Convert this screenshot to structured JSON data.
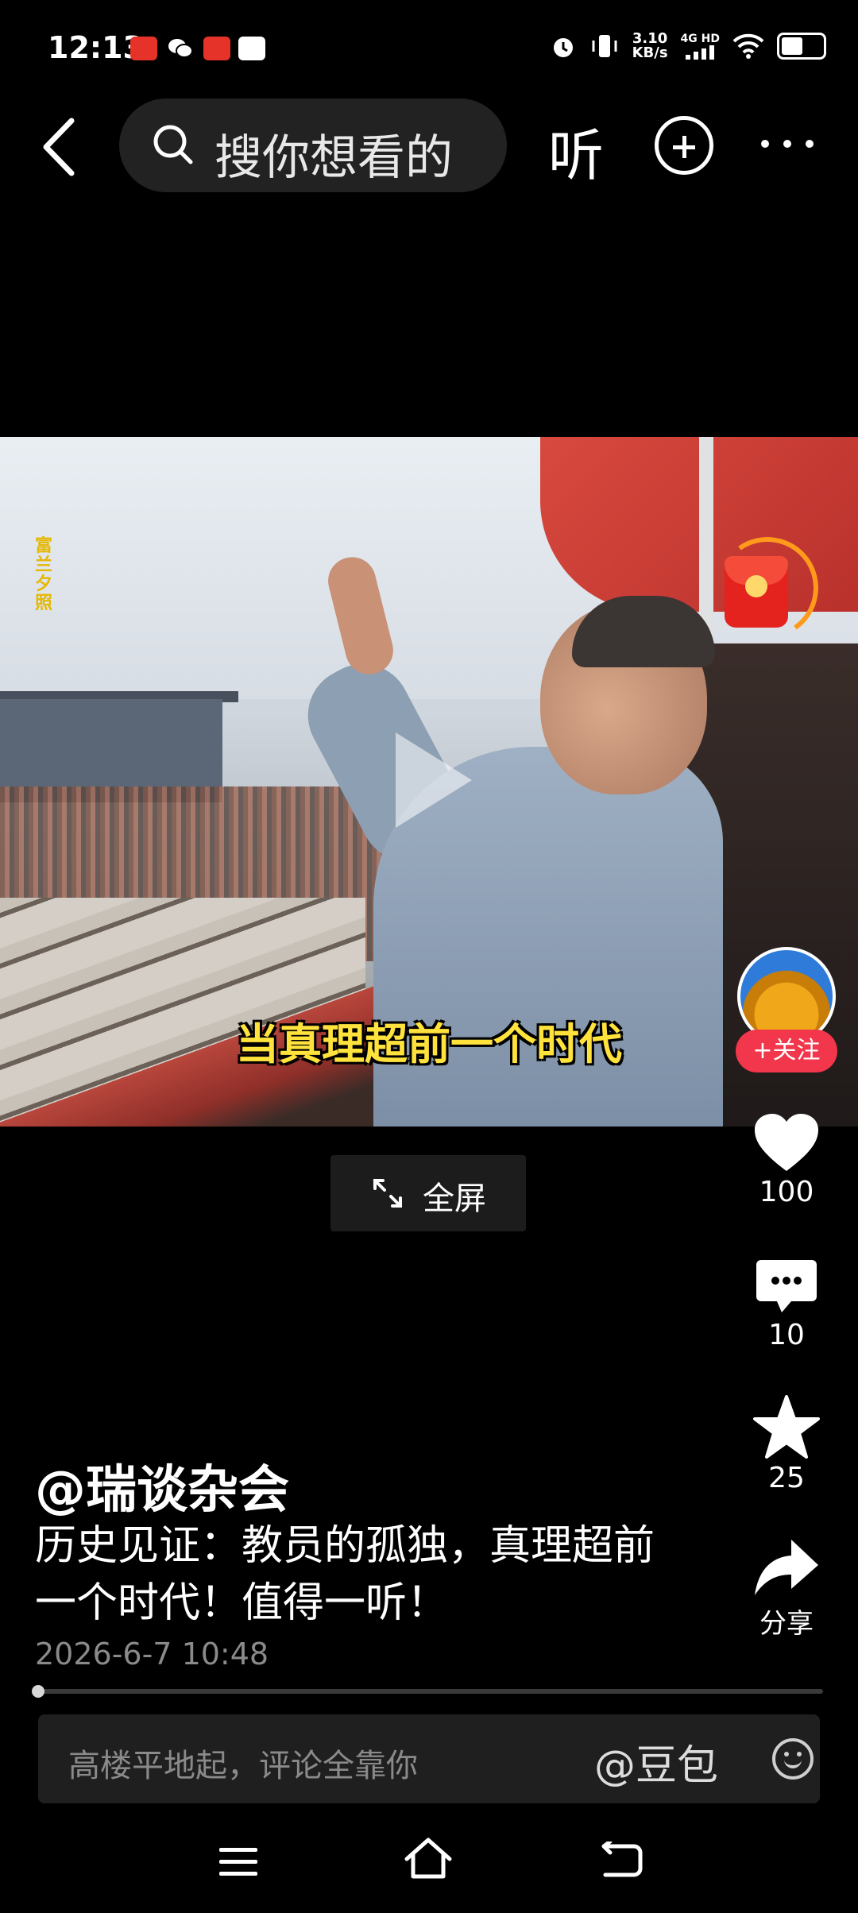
{
  "status_bar": {
    "time": "12:13",
    "net_speed_value": "3.10",
    "net_speed_unit": "KB/s",
    "network_type": "4G HD",
    "battery_level": 0.6
  },
  "top_nav": {
    "search_placeholder": "搜你想看的",
    "listen_label": "听"
  },
  "video": {
    "subtitle": "当真理超前一个时代",
    "watermark": "富兰夕照",
    "fullscreen_label": "全屏"
  },
  "right_rail": {
    "follow_label": "+关注",
    "likes": "100",
    "comments": "10",
    "favorites": "25",
    "share_label": "分享"
  },
  "post": {
    "author": "@瑞谈杂会",
    "caption": "历史见证：教员的孤独，真理超前一个时代！值得一听！",
    "date": "2026-6-7 10:48",
    "progress": 0.0
  },
  "comment_bar": {
    "placeholder": "高楼平地起，评论全靠你",
    "mention": "@豆包"
  },
  "colors": {
    "background": "#000000",
    "follow_red": "#f2364b",
    "subtitle_yellow": "#ffe23c"
  }
}
